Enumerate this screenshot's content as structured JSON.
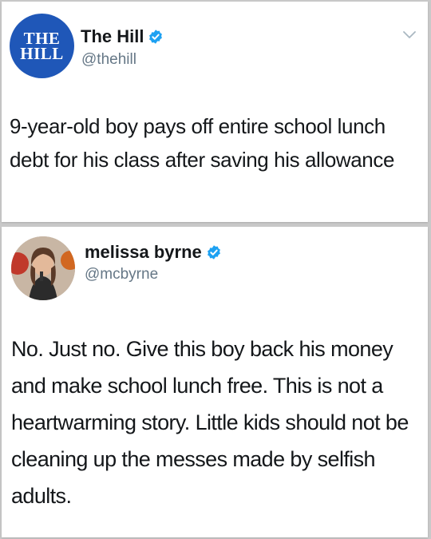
{
  "tweets": [
    {
      "avatar_text_line1": "THE",
      "avatar_text_line2": "HILL",
      "display_name": "The Hill",
      "handle": "@thehill",
      "text": "9-year-old boy pays off entire school lunch debt for his class after saving his allowance",
      "avatar_color": "#1f57b8"
    },
    {
      "display_name": "melissa byrne",
      "handle": "@mcbyrne",
      "text": "No. Just no. Give this boy back his money and make school lunch free. This is not a heartwarming story. Little kids should not be cleaning up the messes made by selfish adults."
    }
  ],
  "icons": {
    "verified": "verified-badge-icon",
    "chevron": "chevron-down-icon"
  },
  "colors": {
    "verified_blue": "#1da1f2",
    "text": "#14171a",
    "handle": "#657786"
  }
}
